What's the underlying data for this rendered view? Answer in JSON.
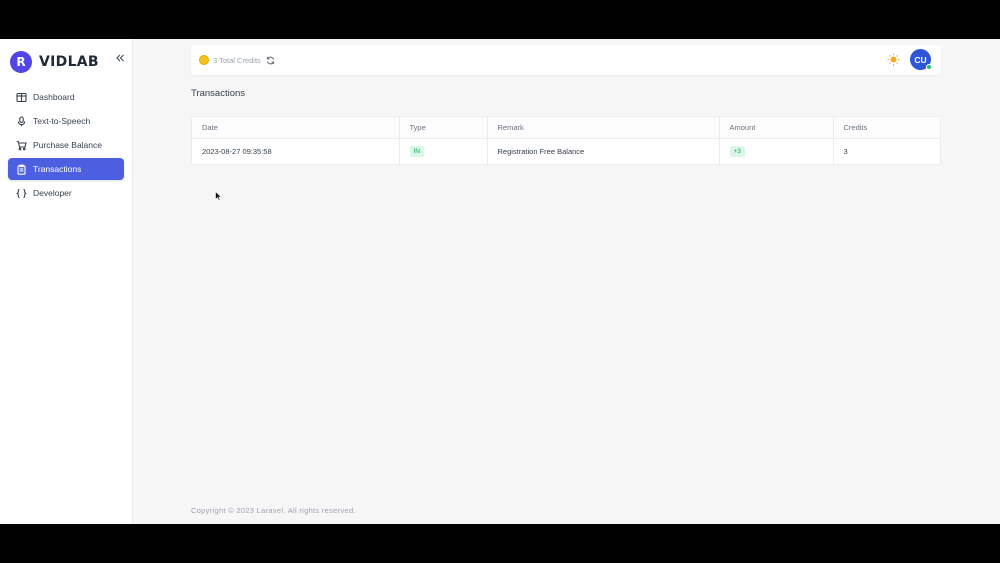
{
  "brand": {
    "name": "VIDLAB",
    "logo_letter": "R",
    "accent": "#4f46e5"
  },
  "sidebar": {
    "items": [
      {
        "label": "Dashboard",
        "icon": "layout-icon"
      },
      {
        "label": "Text-to-Speech",
        "icon": "microphone-icon"
      },
      {
        "label": "Purchase Balance",
        "icon": "cart-icon"
      },
      {
        "label": "Transactions",
        "icon": "clipboard-icon",
        "active": true
      },
      {
        "label": "Developer",
        "icon": "braces-icon"
      }
    ]
  },
  "topbar": {
    "credits_text": "3 Total Credits",
    "avatar_initials": "CU"
  },
  "page": {
    "title": "Transactions"
  },
  "table": {
    "headers": [
      "Date",
      "Type",
      "Remark",
      "Amount",
      "Credits"
    ],
    "rows": [
      {
        "date": "2023-08-27 09:35:58",
        "type": "IN",
        "remark": "Registration Free Balance",
        "amount": "+3",
        "credits": "3"
      }
    ]
  },
  "footer": {
    "text": "Copyright © 2023 Laravel. All rights reserved."
  },
  "colors": {
    "active_nav": "#4c5fe0",
    "badge_bg": "#d9f7e8",
    "badge_fg": "#16a34a"
  }
}
